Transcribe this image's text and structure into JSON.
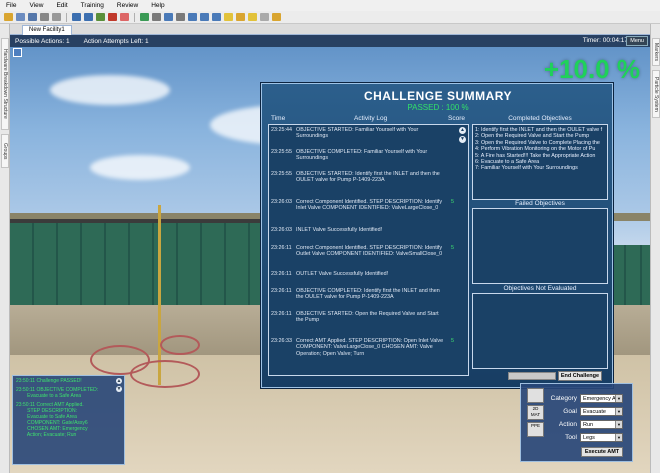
{
  "menu": [
    "File",
    "View",
    "Edit",
    "Training",
    "Review",
    "Help"
  ],
  "tab": {
    "label": "New Facility1"
  },
  "left_tabs": [
    "Hardware Breakdown Structure",
    "Groups"
  ],
  "right_tabs": [
    "Markers",
    "Particle System"
  ],
  "status": {
    "possible_actions": "Possible Actions: 1",
    "attempts_left": "Action Attempts Left: 1",
    "timer": "Timer: 00:04:17",
    "menu_label": "Menu"
  },
  "score": "+10.0 %",
  "summary": {
    "title": "CHALLENGE SUMMARY",
    "passed": "PASSED : 100 %",
    "headers": {
      "time": "Time",
      "activity": "Activity Log",
      "score": "Score"
    },
    "log": [
      {
        "time": "23:25:44",
        "text": "OBJECTIVE STARTED: Familiar Yourself with Your Surroundings",
        "pts": ""
      },
      {
        "time": "23:25:55",
        "text": "OBJECTIVE COMPLETED: Familiar Yourself with Your Surroundings",
        "pts": ""
      },
      {
        "time": "23:25:55",
        "text": "OBJECTIVE STARTED: Identify first the INLET and then the OULET valve for Pump P-1409-223A",
        "pts": ""
      },
      {
        "time": "23:26:03",
        "text": "Correct Component Identified. STEP DESCRIPTION: Identify Inlet Valve COMPONENT IDENTIFIED: ValveLargeClose_0",
        "pts": "5"
      },
      {
        "time": "23:26:03",
        "text": "INLET Valve Successfully Identified!",
        "pts": ""
      },
      {
        "time": "23:26:11",
        "text": "Correct Component Identified. STEP DESCRIPTION: Identify Outlet Valve COMPONENT IDENTIFIED: ValveSmallClose_0",
        "pts": "5"
      },
      {
        "time": "23:26:11",
        "text": "OUTLET Valve Successfully Identified!",
        "pts": ""
      },
      {
        "time": "23:26:11",
        "text": "OBJECTIVE COMPLETED: Identify first the INLET and then the OULET valve for Pump P-1409-223A",
        "pts": ""
      },
      {
        "time": "23:26:11",
        "text": "OBJECTIVE STARTED: Open the Required Valve and Start the Pump",
        "pts": ""
      },
      {
        "time": "23:26:33",
        "text": "Correct AMT Applied. STEP DESCRIPTION: Open Inlet Valve COMPONENT: ValveLargeClose_0 CHOSEN AMT: Valve Operation; Open Valve; Turn",
        "pts": "5"
      }
    ],
    "completed_header": "Completed Objectives",
    "completed": [
      "1: Identify first the INLET and then the OULET valve f",
      "2: Open the Required Valve and Start the Pump",
      "3: Open the Required Valve to Complete Placing the",
      "4: Perform Vibration Monitoring on the Motor of Pu",
      "5: A Fire has Started!!! Take the Appropriate Action",
      "6: Evacuate to a Safe Area",
      "7: Familiar Yourself with Your Surroundings"
    ],
    "failed_header": "Failed Objectives",
    "not_evaluated_header": "Objectives Not Evaluated",
    "end_button": "End Challenge"
  },
  "mini_log": [
    "23:50:11 Challenge PASSED!",
    "",
    "23:50:11 OBJECTIVE COMPLETED:",
    "        Evacuate to a Safe Area",
    "",
    "23:50:11 Correct AMT Applied.",
    "        STEP DESCRIPTION:",
    "        Evacuate to Safe Area",
    "        COMPONENT: Gate/Assy6",
    "        CHOSEN AMT: Emergency",
    "        Action; Evacuate; Run"
  ],
  "amt": {
    "side_buttons": [
      "",
      "2D MAT",
      "PPE"
    ],
    "category_label": "Category",
    "category_value": "Emergency Ac",
    "goal_label": "Goal",
    "goal_value": "Evacuate",
    "action_label": "Action",
    "action_value": "Run",
    "tool_label": "Tool",
    "tool_value": "Legs",
    "execute_label": "Execute AMT"
  }
}
